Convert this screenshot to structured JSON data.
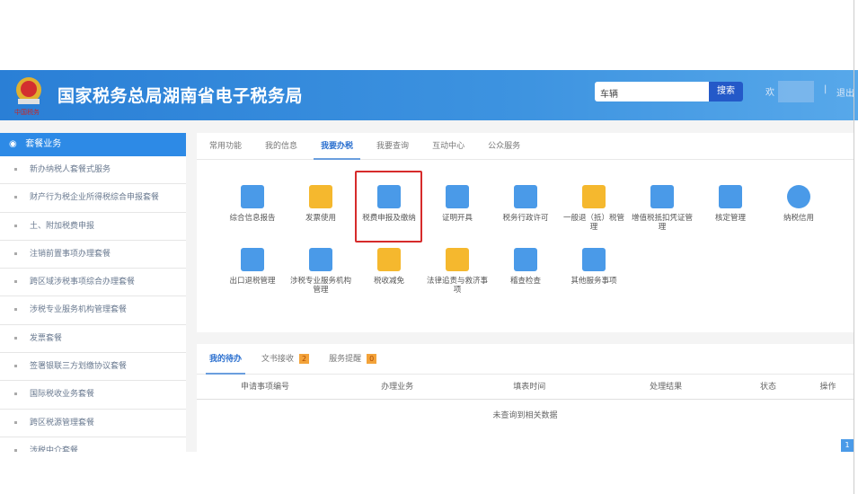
{
  "header": {
    "title": "国家税务总局湖南省电子税务局",
    "search_value": "车辆",
    "search_label": "搜索",
    "user_prefix": "欢",
    "separator": "|",
    "logout": "退出"
  },
  "sidebar": {
    "title": "套餐业务",
    "items": [
      "新办纳税人套餐式服务",
      "财产行为税企业所得税综合申报套餐",
      "土、附加税费申报",
      "注销前置事项办理套餐",
      "跨区域涉税事项综合办理套餐",
      "涉税专业服务机构管理套餐",
      "发票套餐",
      "签署银联三方划缴协议套餐",
      "国际税收业务套餐",
      "跨区税源管理套餐",
      "涉税中介套餐"
    ]
  },
  "main": {
    "tabs": [
      "常用功能",
      "我的信息",
      "我要办税",
      "我要查询",
      "互动中心",
      "公众服务"
    ],
    "active_tab": "我要办税",
    "items": [
      {
        "label": "综合信息报告",
        "icon": "clipboard-icon"
      },
      {
        "label": "发票使用",
        "icon": "invoice-icon"
      },
      {
        "label": "税费申报及缴纳",
        "icon": "hand-coin-icon",
        "highlighted": true
      },
      {
        "label": "证明开具",
        "icon": "document-edit-icon"
      },
      {
        "label": "税务行政许可",
        "icon": "license-icon"
      },
      {
        "label": "一般退（抵）税管理",
        "icon": "folder-icon"
      },
      {
        "label": "增值税抵扣凭证管理",
        "icon": "stamp-doc-icon"
      },
      {
        "label": "核定管理",
        "icon": "monitor-gear-icon"
      },
      {
        "label": "纳税信用",
        "icon": "shield-icon"
      },
      {
        "label": "出口退税管理",
        "icon": "window-gear-icon"
      },
      {
        "label": "涉税专业服务机构管理",
        "icon": "org-chart-icon"
      },
      {
        "label": "税收减免",
        "icon": "yuan-doc-icon"
      },
      {
        "label": "法律追责与救济事项",
        "icon": "legal-icon"
      },
      {
        "label": "稽查检查",
        "icon": "inspect-icon"
      },
      {
        "label": "其他服务事项",
        "icon": "grid-icon"
      }
    ]
  },
  "bottom": {
    "tabs": [
      {
        "label": "我的待办"
      },
      {
        "label": "文书接收",
        "badge": "2"
      },
      {
        "label": "服务提醒",
        "badge": "0"
      }
    ],
    "columns": [
      "申请事项编号",
      "办理业务",
      "填表时间",
      "处理结果",
      "状态",
      "操作"
    ],
    "empty_text": "未查询到相关数据",
    "page": "1"
  },
  "colors": {
    "header_blue": "#2a7fd6",
    "accent": "#2a6fcf",
    "highlight_red": "#d62b2b"
  }
}
